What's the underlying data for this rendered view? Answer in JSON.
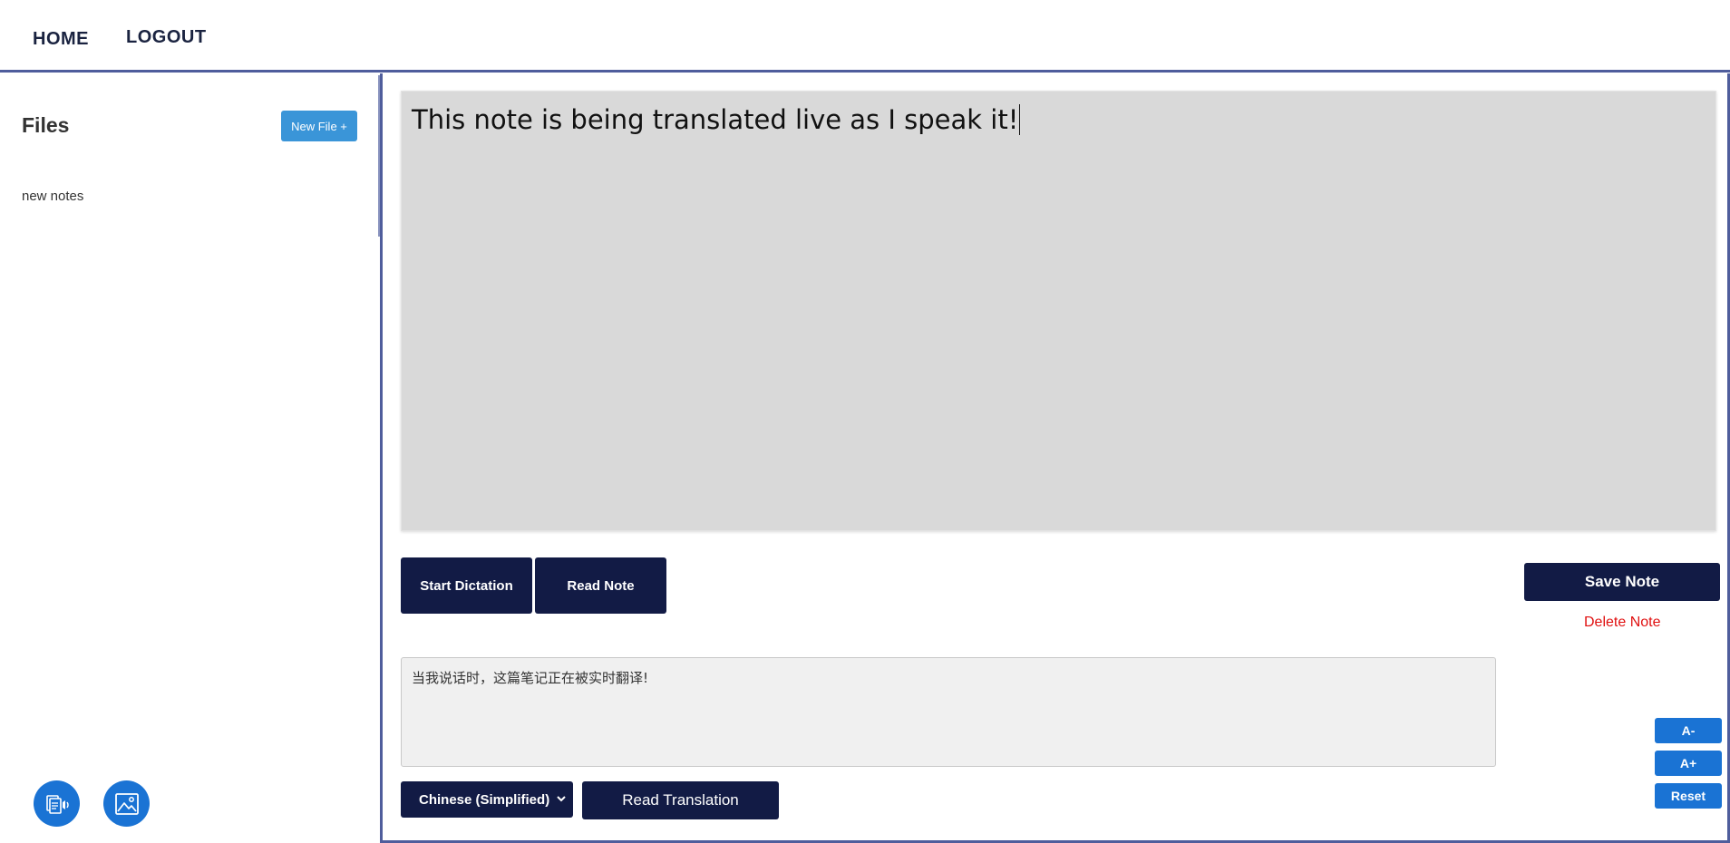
{
  "nav": {
    "home_label": "HOME",
    "logout_label": "LOGOUT"
  },
  "sidebar": {
    "title": "Files",
    "new_file_label": "New File +",
    "files": [
      {
        "name": "new notes"
      }
    ],
    "bottom_buttons": [
      {
        "icon": "text-to-speech-icon"
      },
      {
        "icon": "image-icon"
      }
    ]
  },
  "editor": {
    "note_text": "This note is being translated live as I speak it!"
  },
  "actions": {
    "start_dictation_label": "Start Dictation",
    "read_note_label": "Read Note",
    "save_note_label": "Save Note",
    "delete_note_label": "Delete Note"
  },
  "translation": {
    "text": "当我说话时，这篇笔记正在被实时翻译!",
    "language_selected": "Chinese (Simplified)",
    "read_translation_label": "Read Translation"
  },
  "font_controls": {
    "decrease_label": "A-",
    "increase_label": "A+",
    "reset_label": "Reset"
  },
  "colors": {
    "nav_border": "#4f5d9c",
    "dark_button": "#121b45",
    "blue_button": "#1a73d4",
    "new_file_button": "#3a95d8",
    "delete_text": "#e01010",
    "editor_bg": "#d9d9d9"
  }
}
